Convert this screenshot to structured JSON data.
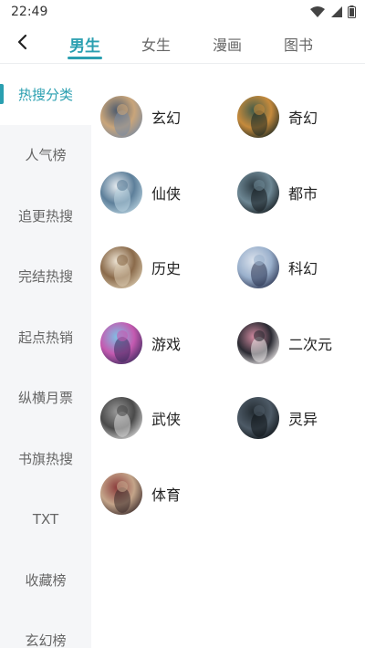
{
  "status": {
    "time": "22:49"
  },
  "tabs": [
    "男生",
    "女生",
    "漫画",
    "图书"
  ],
  "sidebar": {
    "items": [
      "热搜分类",
      "人气榜",
      "追更热搜",
      "完结热搜",
      "起点热销",
      "纵横月票",
      "书旗热搜",
      "TXT",
      "收藏榜",
      "玄幻榜"
    ]
  },
  "categories": [
    {
      "label": "玄幻",
      "colors": [
        "#7a8aa0",
        "#c9a57a",
        "#4b5a6e"
      ]
    },
    {
      "label": "奇幻",
      "colors": [
        "#1e2a24",
        "#c58a3c",
        "#3e5a4a"
      ]
    },
    {
      "label": "仙侠",
      "colors": [
        "#b9d3e0",
        "#5d7f9a",
        "#e9eef2"
      ]
    },
    {
      "label": "都市",
      "colors": [
        "#141a1e",
        "#6d8794",
        "#2c3a42"
      ]
    },
    {
      "label": "历史",
      "colors": [
        "#d9c9ae",
        "#8a6a4a",
        "#efe6d6"
      ]
    },
    {
      "label": "科幻",
      "colors": [
        "#2a3350",
        "#9ab0cc",
        "#dde4ee"
      ]
    },
    {
      "label": "游戏",
      "colors": [
        "#3a2a5c",
        "#c45ab0",
        "#7ec2e6"
      ]
    },
    {
      "label": "二次元",
      "colors": [
        "#f2eeee",
        "#2a2a32",
        "#d28aa0"
      ]
    },
    {
      "label": "武侠",
      "colors": [
        "#d7d7d7",
        "#4a4a4a",
        "#9a9a9a"
      ]
    },
    {
      "label": "灵异",
      "colors": [
        "#0f1418",
        "#4d5a66",
        "#222a30"
      ]
    },
    {
      "label": "体育",
      "colors": [
        "#3a2a2a",
        "#c4a58a",
        "#8a3a3a"
      ]
    }
  ]
}
